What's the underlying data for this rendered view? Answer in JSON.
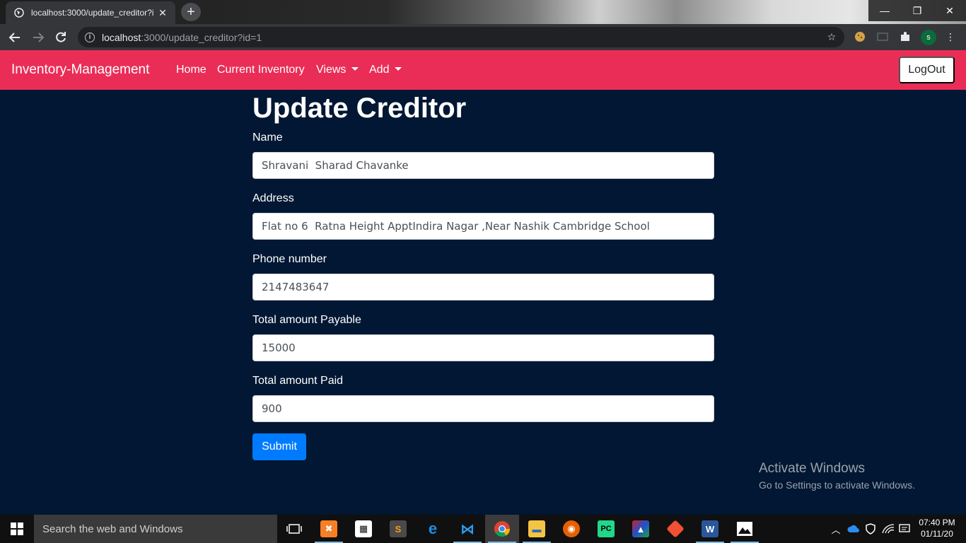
{
  "browser": {
    "tab_title": "localhost:3000/update_creditor?i",
    "url_host": "localhost",
    "url_rest": ":3000/update_creditor?id=1",
    "profile_initial": "s"
  },
  "navbar": {
    "brand": "Inventory-Management",
    "links": [
      {
        "label": "Home"
      },
      {
        "label": "Current Inventory"
      },
      {
        "label": "Views"
      },
      {
        "label": "Add"
      }
    ],
    "logout": "LogOut"
  },
  "form": {
    "title": "Update Creditor",
    "fields": [
      {
        "label": "Name",
        "value": "Shravani  Sharad Chavanke"
      },
      {
        "label": "Address",
        "value": "Flat no 6  Ratna Height ApptIndira Nagar ,Near Nashik Cambridge School"
      },
      {
        "label": "Phone number",
        "value": "2147483647"
      },
      {
        "label": "Total amount Payable",
        "value": "15000"
      },
      {
        "label": "Total amount Paid",
        "value": "900"
      }
    ],
    "submit": "Submit"
  },
  "watermark": {
    "line1": "Activate Windows",
    "line2": "Go to Settings to activate Windows."
  },
  "taskbar": {
    "search_placeholder": "Search the web and Windows",
    "time": "07:40 PM",
    "date": "01/11/20"
  },
  "colors": {
    "navbar": "#ea2d57",
    "page_bg": "#011733",
    "submit": "#007bff"
  }
}
